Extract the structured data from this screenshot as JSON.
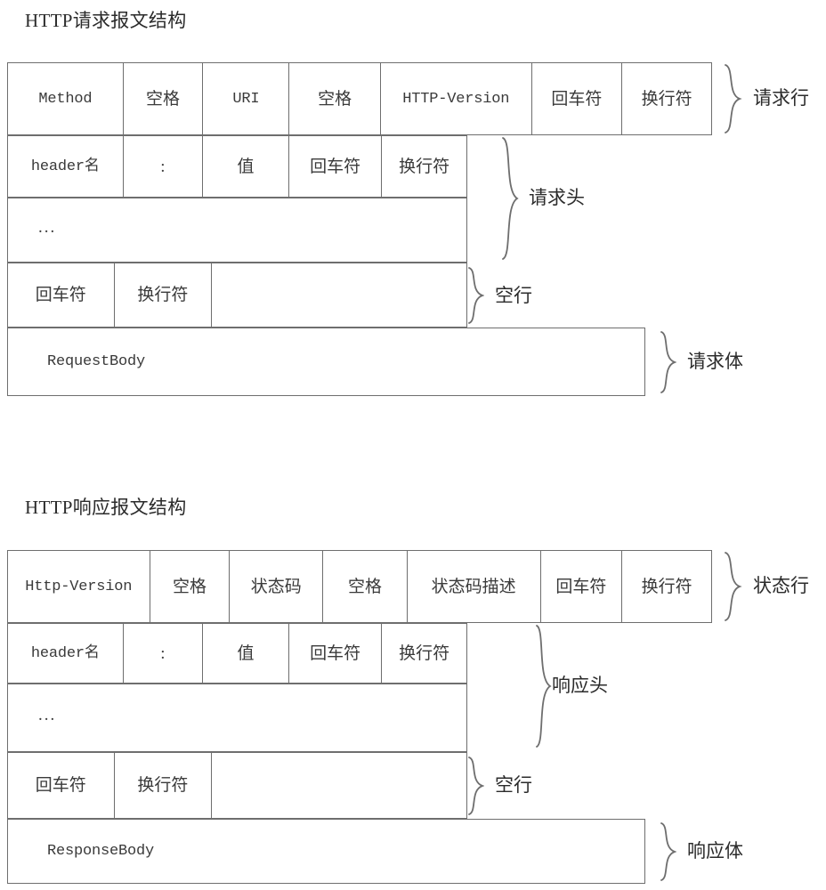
{
  "diagram": {
    "title_request": "HTTP请求报文结构",
    "title_response": "HTTP响应报文结构",
    "request": {
      "request_line": {
        "cells": [
          "Method",
          "空格",
          "URI",
          "空格",
          "HTTP-Version",
          "回车符",
          "换行符"
        ],
        "brace_label": "请求行"
      },
      "header_line": {
        "cells": [
          "header名",
          ":",
          "值",
          "回车符",
          "换行符"
        ]
      },
      "header_more": {
        "cells": [
          "..."
        ]
      },
      "headers_brace_label": "请求头",
      "blank_line": {
        "cells": [
          "回车符",
          "换行符",
          ""
        ],
        "brace_label": "空行"
      },
      "body": {
        "cells": [
          "RequestBody"
        ],
        "brace_label": "请求体"
      }
    },
    "response": {
      "status_line": {
        "cells": [
          "Http-Version",
          "空格",
          "状态码",
          "空格",
          "状态码描述",
          "回车符",
          "换行符"
        ],
        "brace_label": "状态行"
      },
      "header_line": {
        "cells": [
          "header名",
          ":",
          "值",
          "回车符",
          "换行符"
        ]
      },
      "header_more": {
        "cells": [
          "..."
        ]
      },
      "headers_brace_label": "响应头",
      "blank_line": {
        "cells": [
          "回车符",
          "换行符",
          ""
        ],
        "brace_label": "空行"
      },
      "body": {
        "cells": [
          "ResponseBody"
        ],
        "brace_label": "响应体"
      }
    },
    "colors": {
      "stroke": "#6e6e6e",
      "text": "#3a3a3a",
      "background": "#ffffff"
    }
  }
}
